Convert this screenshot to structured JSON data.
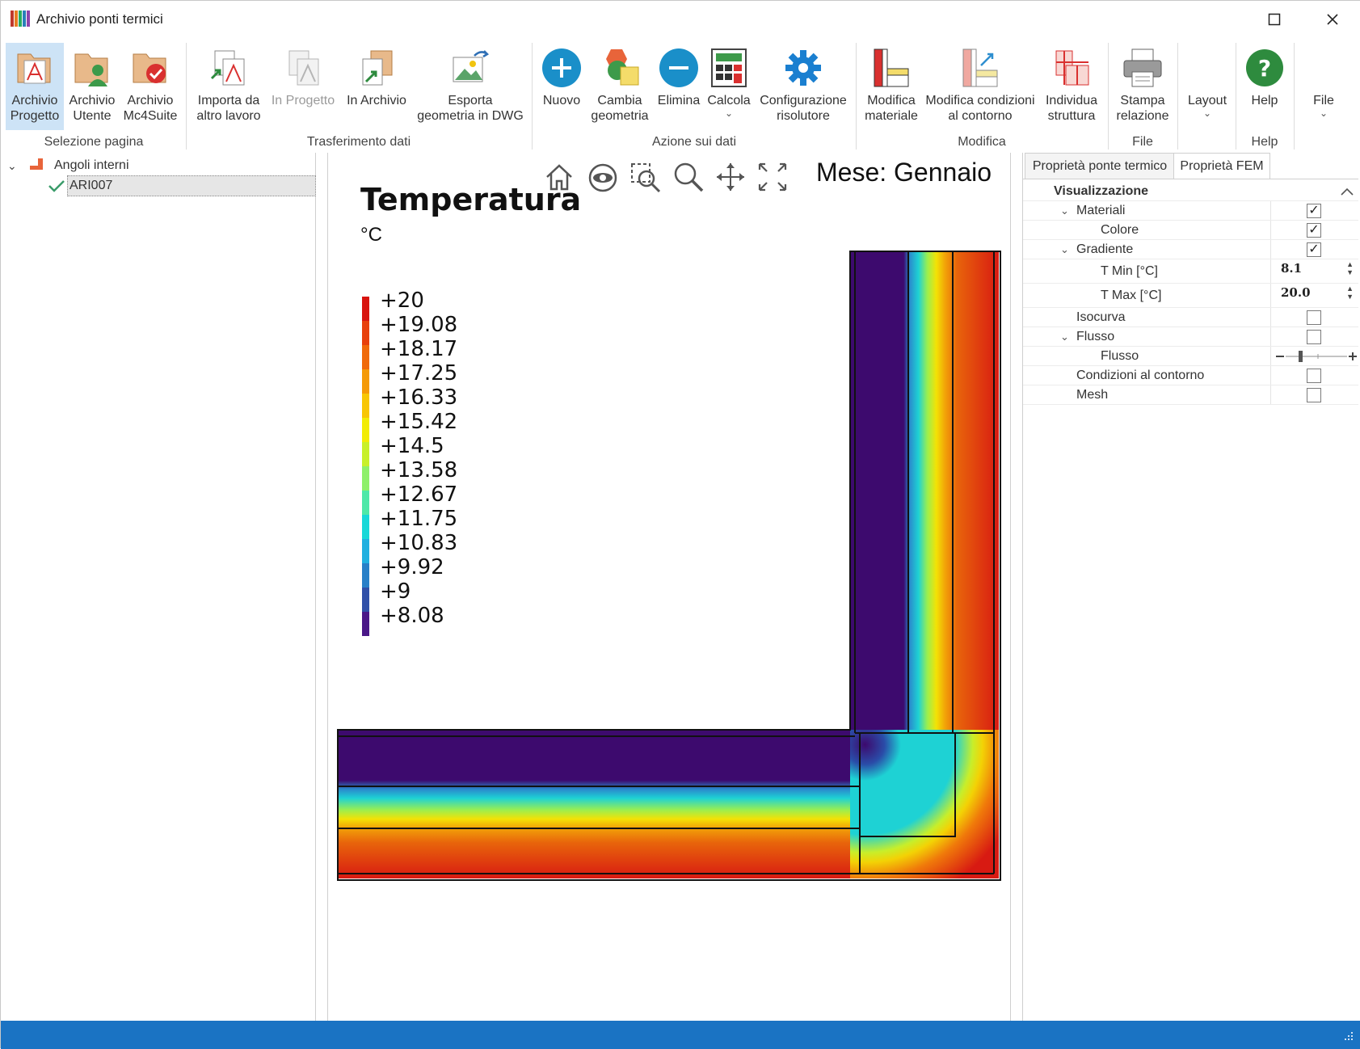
{
  "window": {
    "title": "Archivio ponti termici"
  },
  "ribbon": {
    "buttons": [
      {
        "line1": "Archivio",
        "line2": "Progetto"
      },
      {
        "line1": "Archivio",
        "line2": "Utente"
      },
      {
        "line1": "Archivio",
        "line2": "Mc4Suite"
      },
      {
        "line1": "Importa da",
        "line2": "altro lavoro"
      },
      {
        "line1": "In Progetto",
        "line2": ""
      },
      {
        "line1": "In Archivio",
        "line2": ""
      },
      {
        "line1": "Esporta",
        "line2": "geometria in DWG"
      },
      {
        "line1": "Nuovo",
        "line2": ""
      },
      {
        "line1": "Cambia",
        "line2": "geometria"
      },
      {
        "line1": "Elimina",
        "line2": ""
      },
      {
        "line1": "Calcola",
        "line2": ""
      },
      {
        "line1": "Configurazione",
        "line2": "risolutore"
      },
      {
        "line1": "Modifica",
        "line2": "materiale"
      },
      {
        "line1": "Modifica condizioni",
        "line2": "al contorno"
      },
      {
        "line1": "Individua",
        "line2": "struttura"
      },
      {
        "line1": "Stampa",
        "line2": "relazione"
      },
      {
        "line1": "Layout",
        "line2": ""
      },
      {
        "line1": "Help",
        "line2": ""
      },
      {
        "line1": "File",
        "line2": ""
      }
    ],
    "groups": [
      "Selezione pagina",
      "Trasferimento dati",
      "Azione sui dati",
      "Modifica",
      "File",
      "Help"
    ]
  },
  "tree": {
    "root": "Angoli interni",
    "child": "ARI007"
  },
  "viewer": {
    "title": "Temperatura",
    "unit": "°C",
    "month": "Mese: Gennaio",
    "legend": [
      "+20",
      "+19.08",
      "+18.17",
      "+17.25",
      "+16.33",
      "+15.42",
      "+14.5",
      "+13.58",
      "+12.67",
      "+11.75",
      "+10.83",
      "+9.92",
      "+9",
      "+8.08"
    ],
    "legend_colors": [
      "#d8140f",
      "#e8400c",
      "#f06a0a",
      "#f59a07",
      "#f8c604",
      "#f2ec05",
      "#c8f02a",
      "#8ef06a",
      "#4ee8a8",
      "#18d8d8",
      "#20b0e0",
      "#2880c8",
      "#3050a8",
      "#4a1888"
    ]
  },
  "properties": {
    "tabs": [
      "Proprietà ponte termico",
      "Proprietà FEM"
    ],
    "section": "Visualizzazione",
    "rows": {
      "materiali": "Materiali",
      "colore": "Colore",
      "gradiente": "Gradiente",
      "tmin": "T Min [°C]",
      "tmin_val": "8.1",
      "tmax": "T Max [°C]",
      "tmax_val": "20.0",
      "isocurva": "Isocurva",
      "flusso": "Flusso",
      "flusso_sub": "Flusso",
      "condizioni": "Condizioni al contorno",
      "mesh": "Mesh"
    },
    "checked": {
      "materiali": true,
      "colore": true,
      "gradiente": true,
      "isocurva": false,
      "flusso": false,
      "condizioni": false,
      "mesh": false
    }
  },
  "colors": {
    "accent": "#1a73c3",
    "selected_button": "#cde3f6",
    "wall_cold": "#3d0a6e"
  }
}
